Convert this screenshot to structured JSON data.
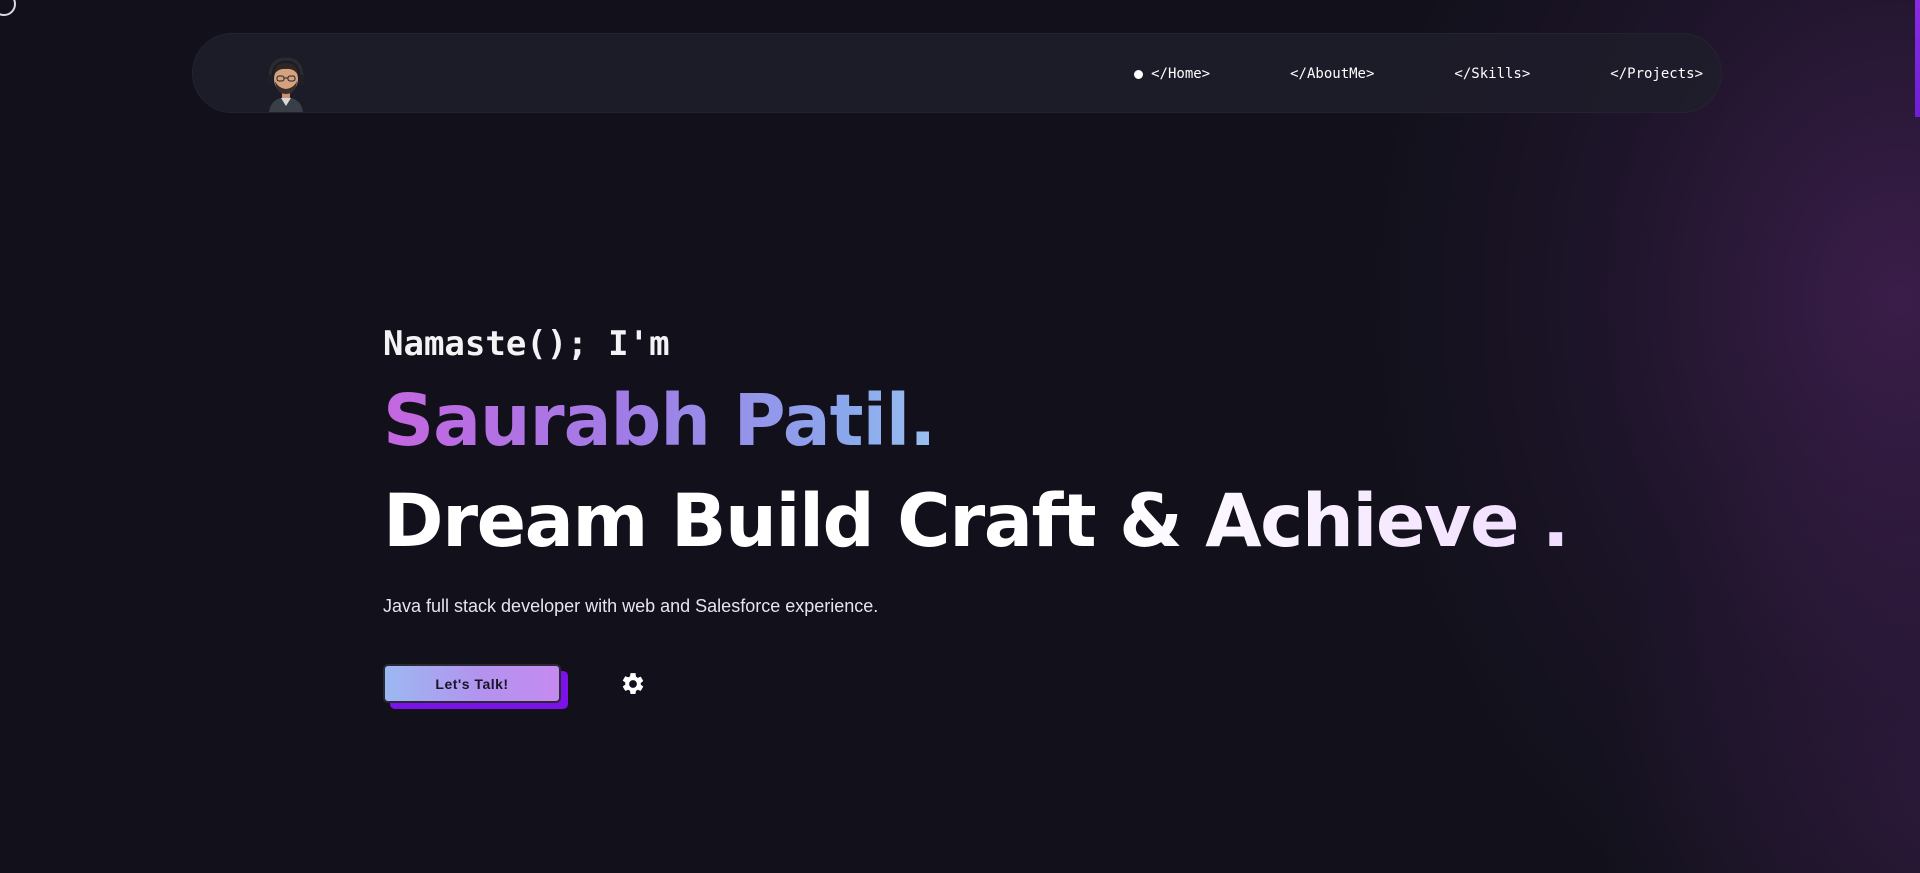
{
  "nav": {
    "items": [
      {
        "label": "</Home>",
        "active": true
      },
      {
        "label": "</AboutMe>",
        "active": false
      },
      {
        "label": "</Skills>",
        "active": false
      },
      {
        "label": "</Projects>",
        "active": false
      }
    ]
  },
  "hero": {
    "greeting": "Namaste(); I'm",
    "name": "Saurabh Patil.",
    "tagline": "Dream Build Craft & Achieve .",
    "description": "Java full stack developer with web and Salesforce experience.",
    "cta_label": "Let's Talk!"
  },
  "icons": {
    "avatar": "avatar-icon",
    "settings": "gear-icon"
  },
  "colors": {
    "background": "#12111b",
    "navbar": "#1e1d2a",
    "accent_purple": "#7b13e8",
    "name_gradient_start": "#c466e0",
    "name_gradient_end": "#9cc0f0"
  }
}
